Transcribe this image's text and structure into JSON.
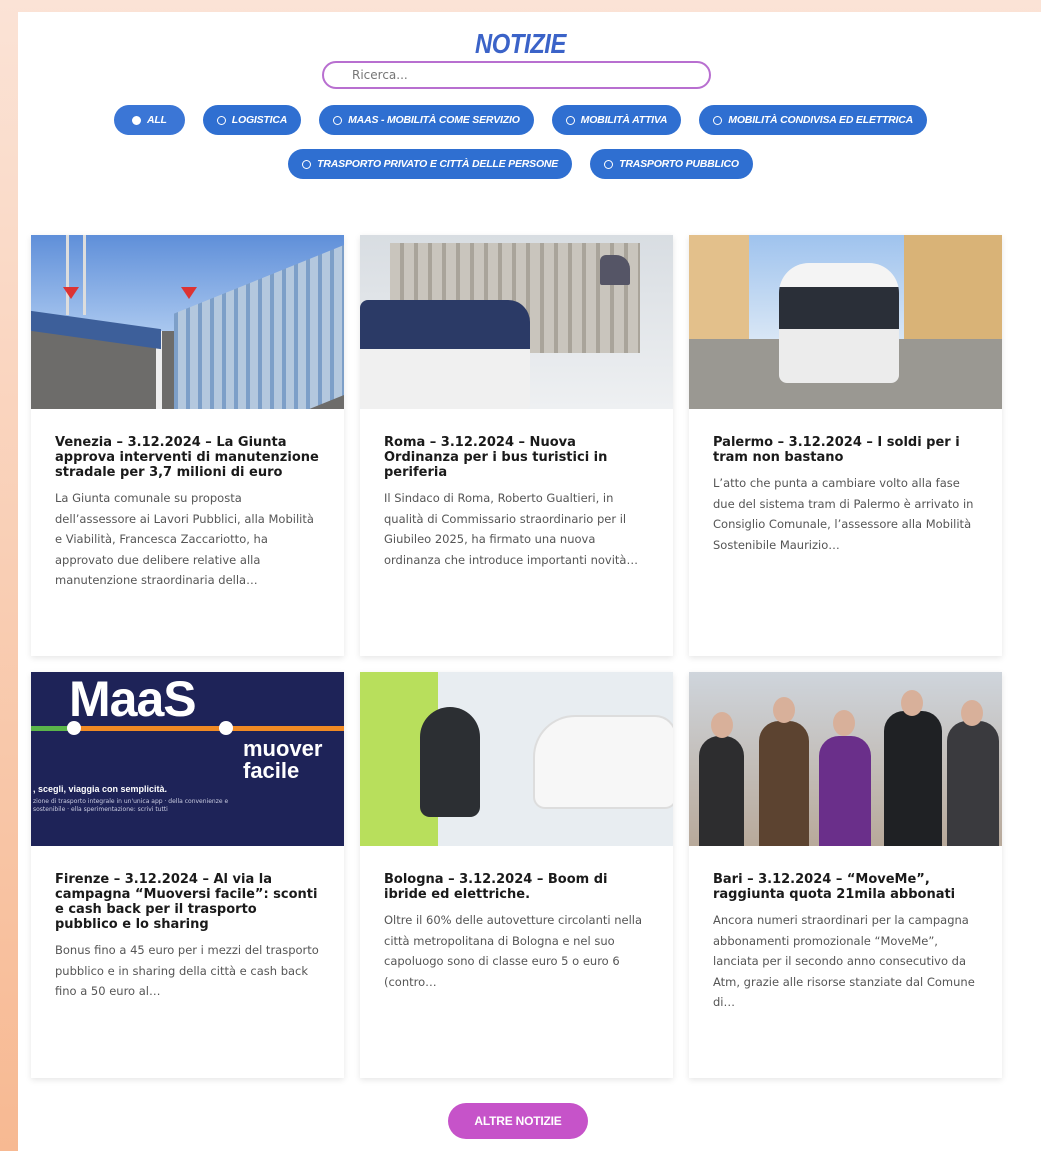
{
  "page": {
    "title": "NOTIZIE",
    "search": {
      "placeholder": "Ricerca..."
    },
    "filters": [
      {
        "label": "ALL",
        "active": true
      },
      {
        "label": "LOGISTICA",
        "active": false
      },
      {
        "label": "MAAS - MOBILITÀ COME SERVIZIO",
        "active": false
      },
      {
        "label": "MOBILITÀ ATTIVA",
        "active": false
      },
      {
        "label": "MOBILITÀ CONDIVISA ED ELETTRICA",
        "active": false
      },
      {
        "label": "TRASPORTO PRIVATO E CITTÀ DELLE PERSONE",
        "active": false
      },
      {
        "label": "TRASPORTO PUBBLICO",
        "active": false
      }
    ],
    "more_button": "ALTRE NOTIZIE",
    "colors": {
      "accent_blue": "#2f6fd1",
      "search_border": "#b86fd0",
      "more_button": "#c653c9"
    }
  },
  "cards": [
    {
      "title": "Venezia – 3.12.2024 – La Giunta approva interventi di manutenzione stradale per 3,7 milioni di euro",
      "excerpt": "La Giunta comunale  su proposta dell’assessore ai Lavori Pubblici, alla Mobilità e Viabilità, Francesca Zaccariotto, ha approvato due delibere relative alla manutenzione straordinaria della…",
      "image": "bridge-road-photo"
    },
    {
      "title": "Roma – 3.12.2024 – Nuova Ordinanza per i bus turistici in periferia",
      "excerpt": "Il Sindaco di Roma, Roberto Gualtieri, in qualità di Commissario straordinario per il Giubileo 2025, ha firmato una nuova ordinanza che introduce importanti novità…",
      "image": "tour-bus-monument-photo"
    },
    {
      "title": "Palermo – 3.12.2024 – I soldi per i tram non bastano",
      "excerpt": "L’atto che punta a cambiare volto alla fase due del sistema tram di Palermo è arrivato in Consiglio Comunale, l’assessore alla Mobilità Sostenibile Maurizio…",
      "image": "tram-street-photo"
    },
    {
      "title": "Firenze – 3.12.2024 – Al via la campagna “Muoversi facile”: sconti e cash back per il trasporto pubblico e lo sharing",
      "excerpt": "Bonus fino a 45 euro per i mezzi del trasporto pubblico e in sharing della città e cash back fino a 50 euro al…",
      "image": "maas-banner",
      "banner": {
        "big": "MaaS",
        "word1": "muover",
        "word2": "facile",
        "tagline": ", scegli, viaggia con semplicità.",
        "fine": "zione di trasporto integrale in un'unica app · della convenienze e sostenibile · ella sperimentazione: scrivi tutti"
      }
    },
    {
      "title": "Bologna – 3.12.2024 – Boom di ibride ed elettriche.",
      "excerpt": "Oltre il 60% delle autovetture circolanti nella città metropolitana di Bologna e nel suo capoluogo sono di classe euro 5 o euro 6 (contro…",
      "image": "ev-charging-photo"
    },
    {
      "title": "Bari – 3.12.2024 – “MoveMe”, raggiunta quota 21mila abbonati",
      "excerpt": "Ancora numeri straordinari per la campagna abbonamenti promozionale “MoveMe”, lanciata per il secondo anno consecutivo da Atm, grazie alle risorse stanziate dal Comune di…",
      "image": "celebration-photo"
    }
  ]
}
